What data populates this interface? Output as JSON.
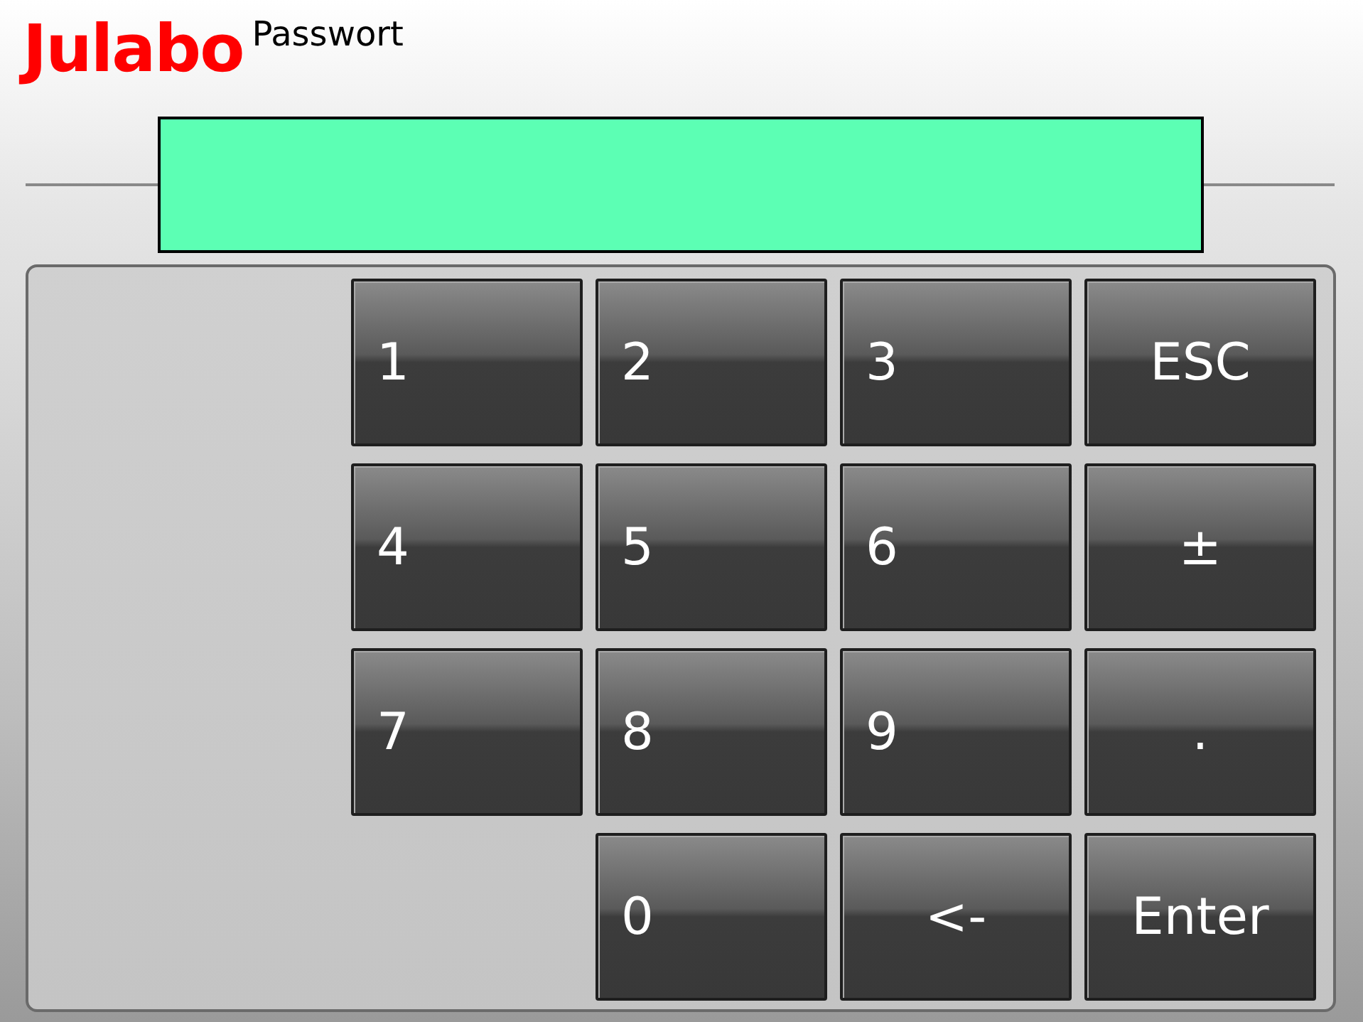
{
  "header": {
    "logo": "Julabo",
    "title": "Passwort"
  },
  "keypad": {
    "rows": [
      [
        {
          "label": "1",
          "kind": "digit"
        },
        {
          "label": "2",
          "kind": "digit"
        },
        {
          "label": "3",
          "kind": "digit"
        },
        {
          "label": "ESC",
          "kind": "function"
        }
      ],
      [
        {
          "label": "4",
          "kind": "digit"
        },
        {
          "label": "5",
          "kind": "digit"
        },
        {
          "label": "6",
          "kind": "digit"
        },
        {
          "label": "±",
          "kind": "function"
        }
      ],
      [
        {
          "label": "7",
          "kind": "digit"
        },
        {
          "label": "8",
          "kind": "digit"
        },
        {
          "label": "9",
          "kind": "digit"
        },
        {
          "label": ".",
          "kind": "function"
        }
      ],
      [
        "",
        {
          "label": "0",
          "kind": "digit"
        },
        {
          "label": "<-",
          "kind": "function"
        },
        {
          "label": "Enter",
          "kind": "function"
        }
      ]
    ]
  }
}
